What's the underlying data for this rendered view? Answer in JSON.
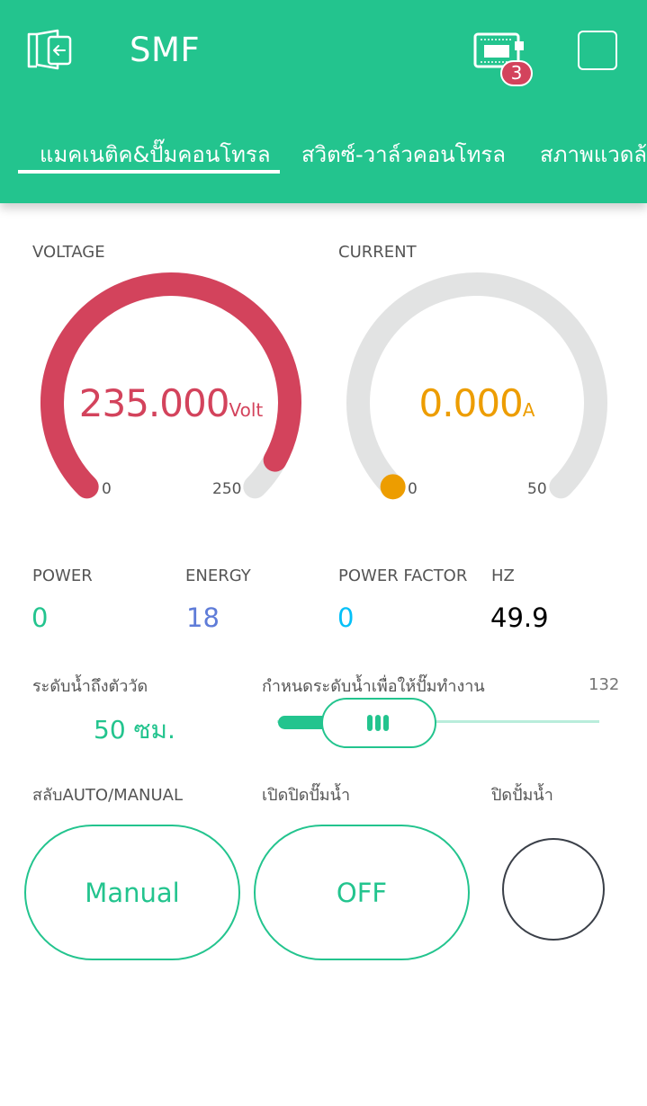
{
  "app": {
    "title": "SMF",
    "notification_count": "3",
    "accent_color": "#23c48e"
  },
  "icons": {
    "back": "exit-project-icon",
    "device": "device-chip-icon",
    "menu": "square-icon"
  },
  "tabs": [
    {
      "label": "แมคเนติค&ปั๊มคอนโทรล",
      "active": true
    },
    {
      "label": "สวิตซ์-วาล์วคอนโทรล",
      "active": false
    },
    {
      "label": "สภาพแวดล้อ",
      "active": false
    }
  ],
  "gauges": {
    "voltage": {
      "label": "VOLTAGE",
      "value": "235.000",
      "value_num": 235,
      "unit": "Volt",
      "min": "0",
      "max": "250",
      "min_num": 0,
      "max_num": 250,
      "color": "#d3435c"
    },
    "current": {
      "label": "CURRENT",
      "value": "0.000",
      "value_num": 0,
      "unit": "A",
      "min": "0",
      "max": "50",
      "min_num": 0,
      "max_num": 50,
      "color": "#ed9d00"
    }
  },
  "displays": {
    "power": {
      "label": "POWER",
      "value": "0",
      "color": "#23c48e"
    },
    "energy": {
      "label": "ENERGY",
      "value": "18",
      "color": "#5f7cd8"
    },
    "power_factor": {
      "label": "POWER FACTOR",
      "value": "0",
      "color": "#04c0f8"
    },
    "hz": {
      "label": "HZ",
      "value": "49.9",
      "color": "#000000"
    }
  },
  "water_level": {
    "label": "ระดับน้ำถึงตัววัด",
    "value": "50 ซม.",
    "color": "#23c48e"
  },
  "slider": {
    "label": "กำหนดระดับน้ำเพื่อให้ปั๊มทำงาน",
    "value": "132"
  },
  "buttons": {
    "auto_manual": {
      "label": "สลับAUTO/MANUAL",
      "text": "Manual"
    },
    "pump_switch": {
      "label": "เปิดปิดปั๊มน้ำ",
      "text": "OFF"
    }
  },
  "led": {
    "label": "ปิดปั้มน้ำ",
    "state": "off"
  }
}
